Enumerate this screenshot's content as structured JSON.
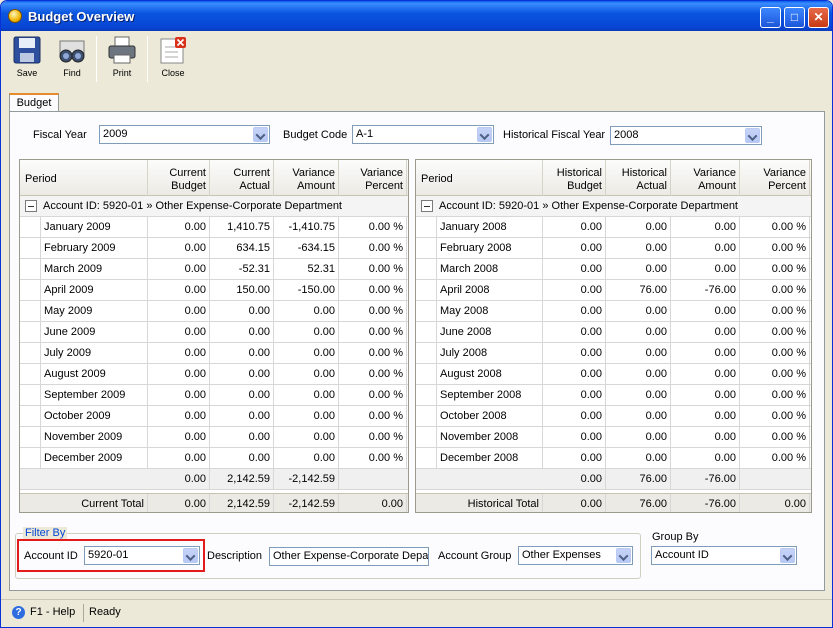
{
  "window": {
    "title": "Budget Overview"
  },
  "toolbar": {
    "save": "Save",
    "find": "Find",
    "print": "Print",
    "close": "Close"
  },
  "tab": {
    "label": "Budget"
  },
  "filters_top": {
    "fiscal_year_label": "Fiscal Year",
    "fiscal_year": "2009",
    "budget_code_label": "Budget Code",
    "budget_code": "A-1",
    "historical_fiscal_year_label": "Historical Fiscal Year",
    "historical_fiscal_year": "2008"
  },
  "left_grid": {
    "headers": {
      "period": "Period",
      "c1a": "Current",
      "c1b": "Budget",
      "c2a": "Current",
      "c2b": "Actual",
      "c3a": "Variance",
      "c3b": "Amount",
      "c4a": "Variance",
      "c4b": "Percent"
    },
    "group": "Account ID: 5920-01 » Other Expense-Corporate Department",
    "rows": [
      [
        "January 2009",
        "0.00",
        "1,410.75",
        "-1,410.75",
        "0.00 %"
      ],
      [
        "February 2009",
        "0.00",
        "634.15",
        "-634.15",
        "0.00 %"
      ],
      [
        "March 2009",
        "0.00",
        "-52.31",
        "52.31",
        "0.00 %"
      ],
      [
        "April 2009",
        "0.00",
        "150.00",
        "-150.00",
        "0.00 %"
      ],
      [
        "May 2009",
        "0.00",
        "0.00",
        "0.00",
        "0.00 %"
      ],
      [
        "June 2009",
        "0.00",
        "0.00",
        "0.00",
        "0.00 %"
      ],
      [
        "July 2009",
        "0.00",
        "0.00",
        "0.00",
        "0.00 %"
      ],
      [
        "August 2009",
        "0.00",
        "0.00",
        "0.00",
        "0.00 %"
      ],
      [
        "September 2009",
        "0.00",
        "0.00",
        "0.00",
        "0.00 %"
      ],
      [
        "October 2009",
        "0.00",
        "0.00",
        "0.00",
        "0.00 %"
      ],
      [
        "November 2009",
        "0.00",
        "0.00",
        "0.00",
        "0.00 %"
      ],
      [
        "December 2009",
        "0.00",
        "0.00",
        "0.00",
        "0.00 %"
      ]
    ],
    "subtotal": [
      "0.00",
      "2,142.59",
      "-2,142.59"
    ],
    "total_label": "Current Total",
    "total": [
      "0.00",
      "2,142.59",
      "-2,142.59",
      "0.00"
    ]
  },
  "right_grid": {
    "headers": {
      "period": "Period",
      "c1a": "Historical",
      "c1b": "Budget",
      "c2a": "Historical",
      "c2b": "Actual",
      "c3a": "Variance",
      "c3b": "Amount",
      "c4a": "Variance",
      "c4b": "Percent"
    },
    "group": "Account ID: 5920-01 » Other Expense-Corporate Department",
    "rows": [
      [
        "January 2008",
        "0.00",
        "0.00",
        "0.00",
        "0.00 %"
      ],
      [
        "February 2008",
        "0.00",
        "0.00",
        "0.00",
        "0.00 %"
      ],
      [
        "March 2008",
        "0.00",
        "0.00",
        "0.00",
        "0.00 %"
      ],
      [
        "April 2008",
        "0.00",
        "76.00",
        "-76.00",
        "0.00 %"
      ],
      [
        "May 2008",
        "0.00",
        "0.00",
        "0.00",
        "0.00 %"
      ],
      [
        "June 2008",
        "0.00",
        "0.00",
        "0.00",
        "0.00 %"
      ],
      [
        "July 2008",
        "0.00",
        "0.00",
        "0.00",
        "0.00 %"
      ],
      [
        "August 2008",
        "0.00",
        "0.00",
        "0.00",
        "0.00 %"
      ],
      [
        "September 2008",
        "0.00",
        "0.00",
        "0.00",
        "0.00 %"
      ],
      [
        "October 2008",
        "0.00",
        "0.00",
        "0.00",
        "0.00 %"
      ],
      [
        "November 2008",
        "0.00",
        "0.00",
        "0.00",
        "0.00 %"
      ],
      [
        "December 2008",
        "0.00",
        "0.00",
        "0.00",
        "0.00 %"
      ]
    ],
    "subtotal": [
      "0.00",
      "76.00",
      "-76.00"
    ],
    "total_label": "Historical Total",
    "total": [
      "0.00",
      "76.00",
      "-76.00",
      "0.00"
    ]
  },
  "filter_by": {
    "legend": "Filter By",
    "account_id_label": "Account ID",
    "account_id": "5920-01",
    "description_label": "Description",
    "description": "Other Expense-Corporate Depar",
    "account_group_label": "Account Group",
    "account_group": "Other Expenses"
  },
  "group_by": {
    "label": "Group By",
    "value": "Account ID"
  },
  "statusbar": {
    "help": "F1 - Help",
    "status": "Ready"
  },
  "colors": {
    "titlebar": "#0a56e0",
    "highlight": "#e31b1b",
    "tab_accent": "#e68b2c"
  }
}
